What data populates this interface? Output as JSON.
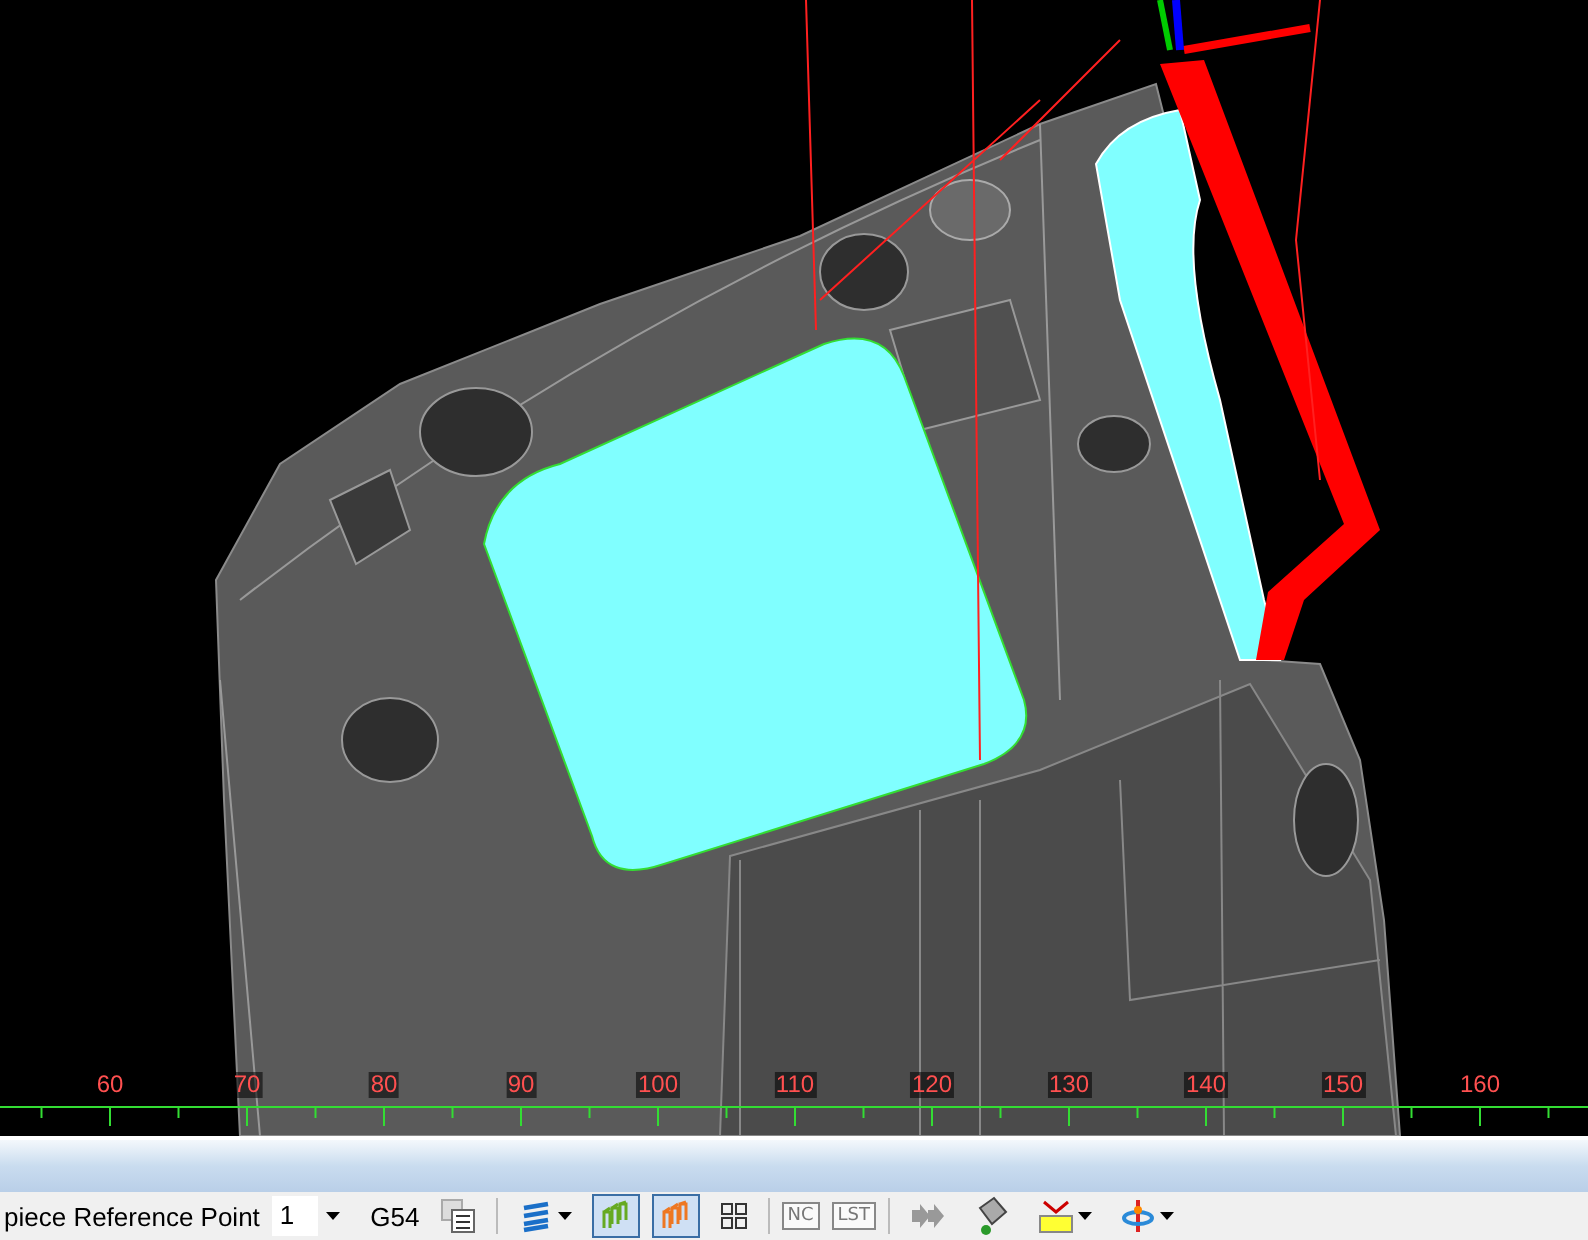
{
  "viewport": {
    "ruler": {
      "labels": [
        "60",
        "70",
        "80",
        "90",
        "100",
        "110",
        "120",
        "130",
        "140",
        "150",
        "160"
      ]
    }
  },
  "toolbar": {
    "reference_label": "piece Reference Point",
    "reference_value": "1",
    "offset": "G54",
    "view_toggles": [
      {
        "selected": true
      },
      {
        "selected": true
      }
    ],
    "nc_button": "NC",
    "list_button": "LST"
  }
}
